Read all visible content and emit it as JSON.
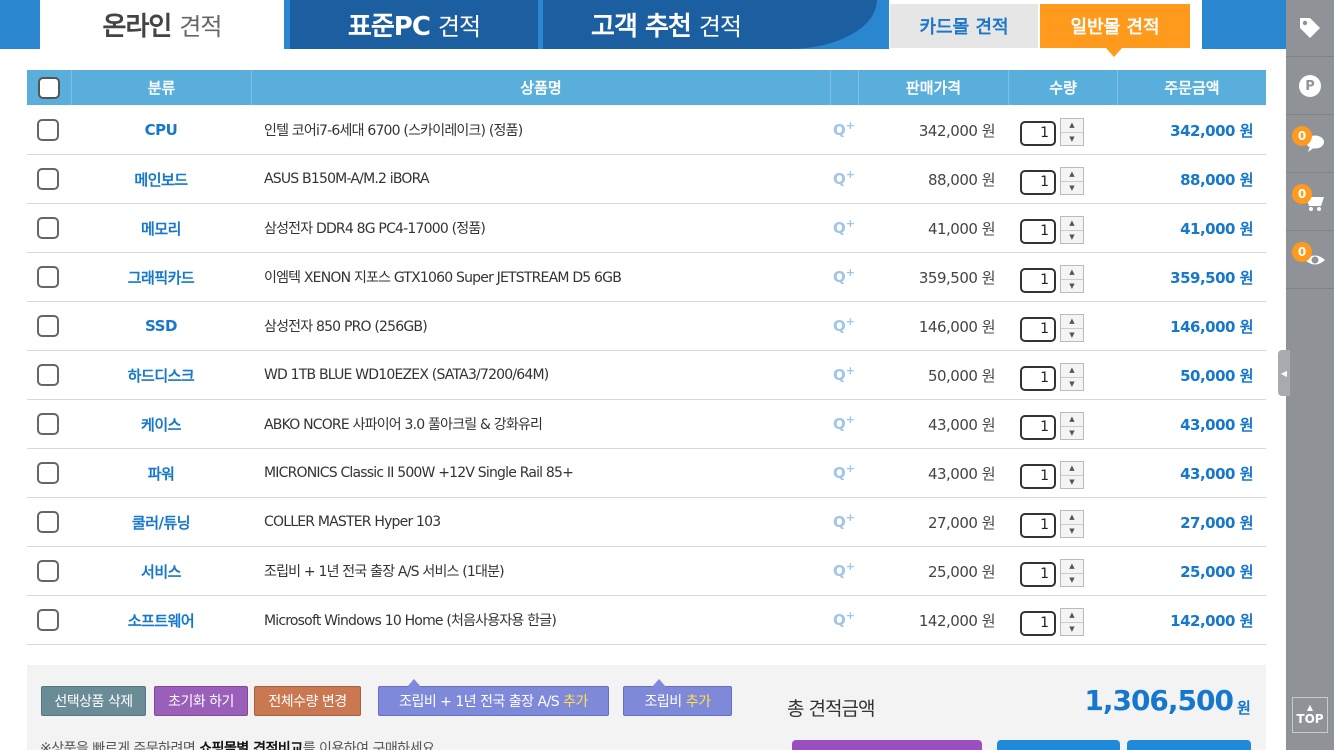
{
  "tabs": {
    "online": {
      "main": "온라인",
      "sub": "견적"
    },
    "standard": {
      "main": "표준PC",
      "sub": "견적"
    },
    "recommend": {
      "main": "고객 추천",
      "sub": "견적"
    },
    "card_mall": "카드몰 견적",
    "general_mall": "일반몰 견적"
  },
  "table": {
    "headers": {
      "category": "분류",
      "product": "상품명",
      "price": "판매가격",
      "quantity": "수량",
      "total": "주문금액"
    },
    "rows": [
      {
        "category": "CPU",
        "product": "인텔 코어i7-6세대 6700 (스카이레이크) (정품)",
        "price": "342,000 원",
        "qty": "1",
        "total": "342,000 원"
      },
      {
        "category": "메인보드",
        "product": "ASUS B150M-A/M.2 iBORA",
        "price": "88,000 원",
        "qty": "1",
        "total": "88,000 원"
      },
      {
        "category": "메모리",
        "product": "삼성전자 DDR4 8G PC4-17000 (정품)",
        "price": "41,000 원",
        "qty": "1",
        "total": "41,000 원"
      },
      {
        "category": "그래픽카드",
        "product": "이엠텍 XENON 지포스 GTX1060 Super JETSTREAM D5 6GB",
        "price": "359,500 원",
        "qty": "1",
        "total": "359,500 원"
      },
      {
        "category": "SSD",
        "product": "삼성전자 850 PRO (256GB)",
        "price": "146,000 원",
        "qty": "1",
        "total": "146,000 원"
      },
      {
        "category": "하드디스크",
        "product": "WD 1TB BLUE WD10EZEX (SATA3/7200/64M)",
        "price": "50,000 원",
        "qty": "1",
        "total": "50,000 원"
      },
      {
        "category": "케이스",
        "product": "ABKO NCORE 사파이어 3.0 풀아크릴 & 강화유리",
        "price": "43,000 원",
        "qty": "1",
        "total": "43,000 원"
      },
      {
        "category": "파워",
        "product": "MICRONICS Classic II 500W +12V Single Rail 85+",
        "price": "43,000 원",
        "qty": "1",
        "total": "43,000 원"
      },
      {
        "category": "쿨러/튜닝",
        "product": "COLLER MASTER Hyper 103",
        "price": "27,000 원",
        "qty": "1",
        "total": "27,000 원"
      },
      {
        "category": "서비스",
        "product": "조립비 + 1년 전국 출장 A/S 서비스 (1대분)",
        "price": "25,000 원",
        "qty": "1",
        "total": "25,000 원"
      },
      {
        "category": "소프트웨어",
        "product": "Microsoft Windows 10 Home (처음사용자용 한글)",
        "price": "142,000 원",
        "qty": "1",
        "total": "142,000 원"
      }
    ]
  },
  "buttons": {
    "delete_selected": "선택상품 삭제",
    "reset": "초기화 하기",
    "change_all_qty": "전체수량 변경",
    "assembly_as": "조립비 + 1년 전국 출장 A/S",
    "assembly": "조립비",
    "add": "추가"
  },
  "summary": {
    "total_label": "총 견적금액",
    "total_value": "1,306,500",
    "unit": "원"
  },
  "notice": {
    "prefix": "※상품을 빠르게 주문하려면 ",
    "bold": "쇼핑몰별 견적비교",
    "suffix": "를 이용하여 구매하세요."
  },
  "sidebar": {
    "badges": [
      "0",
      "0",
      "0"
    ],
    "p_label": "P",
    "top_label": "TOP"
  },
  "icons": {
    "tag": "tag-icon",
    "point": "point-icon",
    "chat": "chat-icon",
    "cart": "cart-icon",
    "view": "eye-icon",
    "zoom": "zoom-plus-icon"
  },
  "colors": {
    "primary_blue": "#2b86d0",
    "header_blue": "#5aaedc",
    "accent_orange": "#ff9a1c",
    "price_blue": "#1578cc"
  }
}
